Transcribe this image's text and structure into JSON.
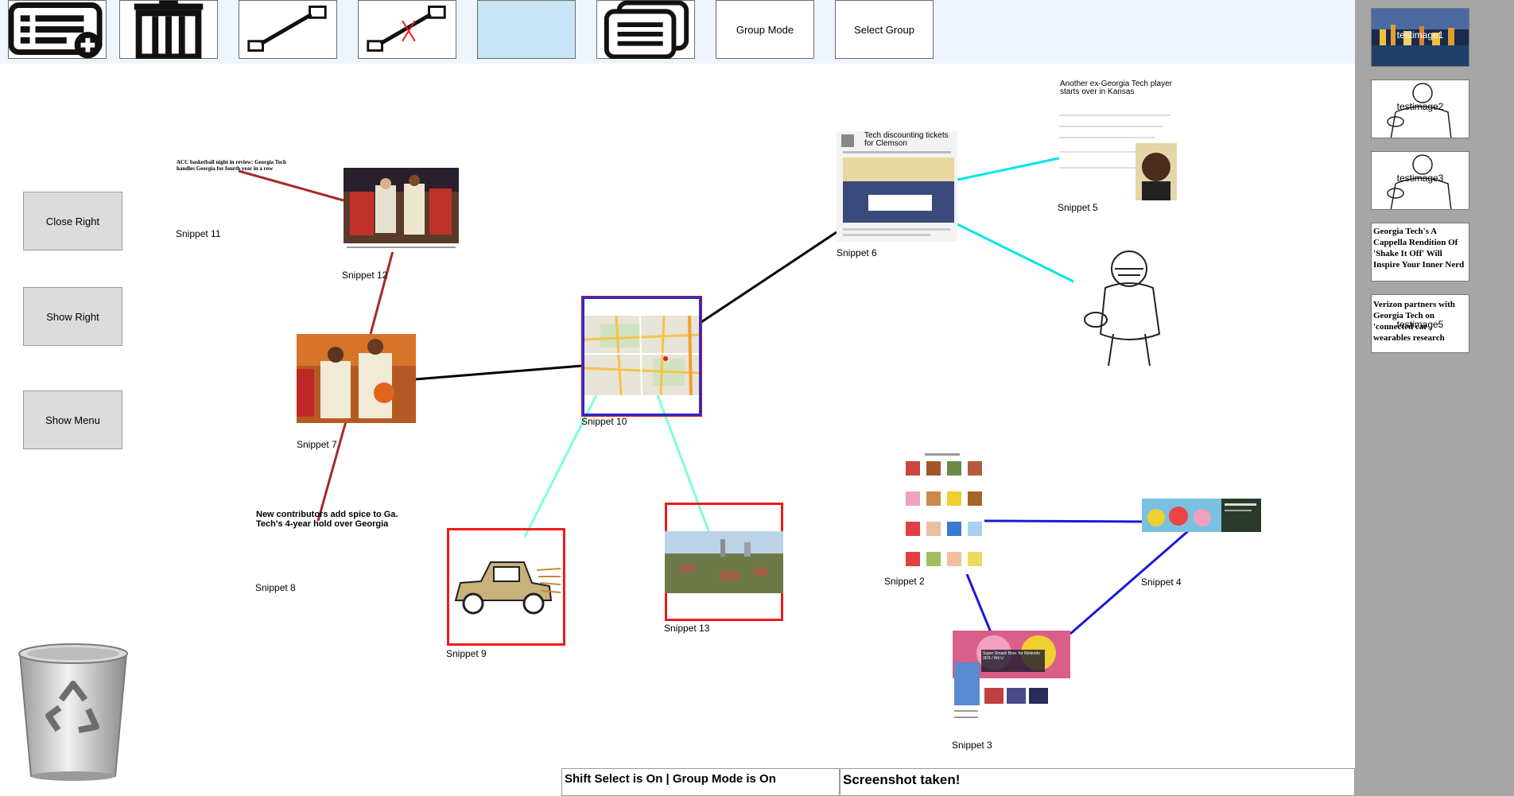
{
  "toolbar": {
    "group_mode_label": "Group Mode",
    "select_group_label": "Select Group"
  },
  "side_buttons": {
    "close_right": "Close Right",
    "show_right": "Show Right",
    "show_menu": "Show Menu"
  },
  "right_panel": {
    "thumbnails": [
      {
        "label": "testimage1"
      },
      {
        "label": "testimage2"
      },
      {
        "label": "testimage3"
      },
      {
        "label": "",
        "text": "Georgia Tech's A Cappella Rendition Of 'Shake It Off' Will Inspire Your Inner Nerd"
      },
      {
        "label": "testimage5",
        "text": "Verizon partners with Georgia Tech on 'connected car', wearables research"
      }
    ]
  },
  "snippets": {
    "s2": "Snippet 2",
    "s3": "Snippet 3",
    "s4": "Snippet 4",
    "s5": "Snippet 5",
    "s6": "Snippet 6",
    "s7": "Snippet 7",
    "s8": "Snippet 8",
    "s9": "Snippet 9",
    "s10": "Snippet 10",
    "s11": "Snippet 11",
    "s12": "Snippet 12",
    "s13": "Snippet 13"
  },
  "snippet_text": {
    "s11_headline": "ACC basketball night in review: Georgia Tech handles Georgia for fourth year in a row",
    "s8_headline": "New contributors add spice to Ga. Tech's 4-year hold over Georgia",
    "s5_headline": "Another ex-Georgia Tech player starts over in Kansas",
    "s6_headline": "Tech discounting tickets for Clemson",
    "s3_headline": "Super Smash Bros. for Nintendo 3DS / Wii U"
  },
  "status": {
    "mode": "Shift Select is On | Group Mode is On",
    "message": "Screenshot taken!"
  },
  "colors": {
    "toolbar_bg": "#eef5fd",
    "highlight_button": "#c7e3f6",
    "right_panel_bg": "#a6a6a6",
    "link_black": "#000000",
    "link_dark_red": "#a52a2a",
    "link_cyan": "#00e5ee",
    "link_aquamarine": "#7fffd4",
    "link_blue": "#1a1ad6",
    "frame_red": "#ee1b1b"
  },
  "icons": [
    "add-list-icon",
    "trash-icon",
    "link-icon",
    "unlink-icon",
    "copy-icon",
    "recycle-bin-icon"
  ]
}
